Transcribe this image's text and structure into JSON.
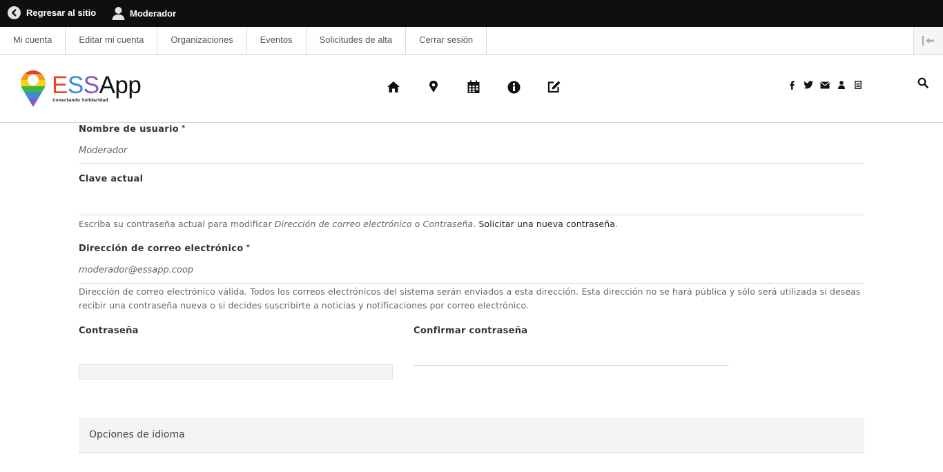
{
  "toolbar": {
    "back_label": "Regresar al sitio",
    "user_label": "Moderador"
  },
  "tray": {
    "tabs": [
      "Mi cuenta",
      "Editar mi cuenta",
      "Organizaciones",
      "Eventos",
      "Solicitudes de alta",
      "Cerrar sesión"
    ]
  },
  "header": {
    "logo": {
      "name_e": "E",
      "name_s1": "S",
      "name_s2": "S",
      "name_app": "App",
      "tagline": "Conectando Solidaridad"
    },
    "nav_icons": [
      "home-icon",
      "map-marker-icon",
      "calendar-icon",
      "info-icon",
      "edit-icon"
    ],
    "social_icons": [
      "facebook-icon",
      "twitter-icon",
      "envelope-icon",
      "user-icon",
      "document-icon"
    ]
  },
  "form": {
    "username": {
      "label": "Nombre de usuario",
      "required_mark": "*",
      "value": "Moderador"
    },
    "current_password": {
      "label": "Clave actual",
      "desc_prefix": "Escriba su contraseña actual para modificar ",
      "desc_em1": "Dirección de correo electrónico",
      "desc_mid": " o ",
      "desc_em2": "Contraseña",
      "desc_link": "Solicitar una nueva contraseña",
      "desc_end": "."
    },
    "email": {
      "label": "Dirección de correo electrónico",
      "required_mark": "*",
      "value": "moderador@essapp.coop",
      "description": "Dirección de correo electrónico válida. Todos los correos electrónicos del sistema serán enviados a esta dirección. Esta dirección no se hará pública y sólo será utilizada si deseas recibir una contraseña nueva o si decides suscribirte a noticias y notificaciones por correo electrónico."
    },
    "password": {
      "label": "Contraseña"
    },
    "confirm_password": {
      "label": "Confirmar contraseña"
    },
    "language_section": {
      "title": "Opciones de idioma"
    }
  }
}
